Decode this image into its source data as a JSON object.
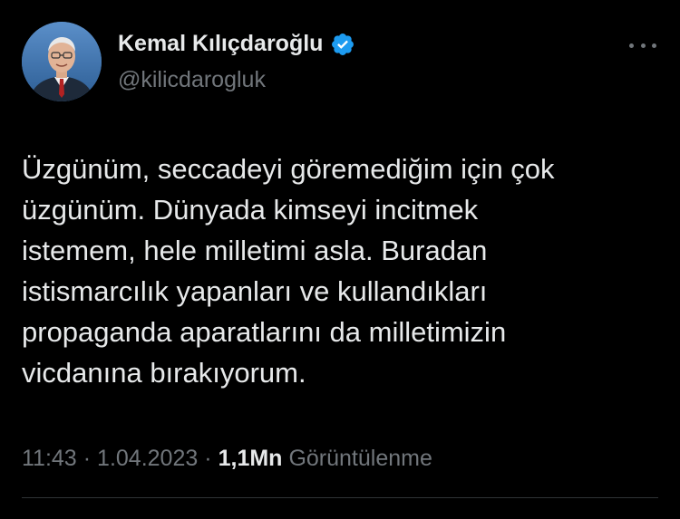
{
  "author": {
    "name": "Kemal Kılıçdaroğlu",
    "handle": "@kilicdarogluk",
    "verified": true
  },
  "icons": {
    "avatar": "profile-photo",
    "verified": "verified-badge-icon",
    "more": "more-options-icon"
  },
  "colors": {
    "background": "#000000",
    "primary_text": "#e7e9ea",
    "secondary_text": "#71767b",
    "verified_badge": "#1d9bf0",
    "divider": "#2f3336"
  },
  "tweet": {
    "text_lines": [
      "Üzgünüm, seccadeyi göremediğim için çok",
      "üzgünüm. Dünyada kimseyi incitmek",
      "istemem, hele milletimi asla. Buradan",
      "istismarcılık yapanları ve kullandıkları",
      "propaganda aparatlarını da milletimizin",
      "vicdanına bırakıyorum."
    ],
    "time": "11:43",
    "date": "1.04.2023",
    "separator": "·",
    "views_count": "1,1Mn",
    "views_label": "Görüntülenme"
  }
}
